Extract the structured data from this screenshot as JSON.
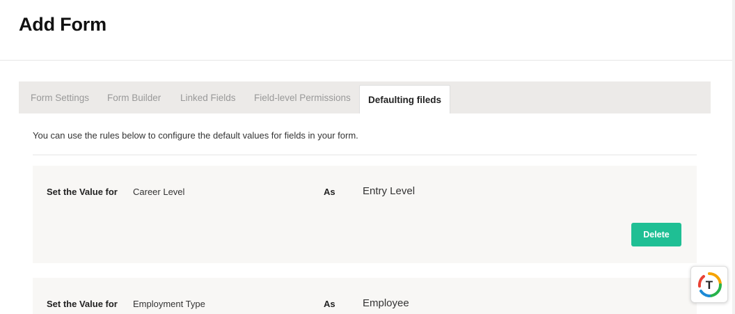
{
  "page": {
    "title": "Add Form"
  },
  "tabs": [
    {
      "label": "Form Settings",
      "active": false
    },
    {
      "label": "Form Builder",
      "active": false
    },
    {
      "label": "Linked Fields",
      "active": false
    },
    {
      "label": "Field-level Permissions",
      "active": false
    },
    {
      "label": "Defaulting fileds",
      "active": true
    }
  ],
  "intro": "You can use the rules below to configure the default values for fields in your form.",
  "rules": [
    {
      "set_label": "Set the Value for",
      "field": "Career Level",
      "as_label": "As",
      "value": "Entry Level",
      "delete_label": "Delete"
    },
    {
      "set_label": "Set the Value for",
      "field": "Employment Type",
      "as_label": "As",
      "value": "Employee"
    }
  ],
  "colors": {
    "accent": "#1fbf94",
    "tab_bar": "#eceae8",
    "card_bg": "#f8f7f5"
  },
  "widget": {
    "icon": "t-logo-icon",
    "letter": "T"
  }
}
